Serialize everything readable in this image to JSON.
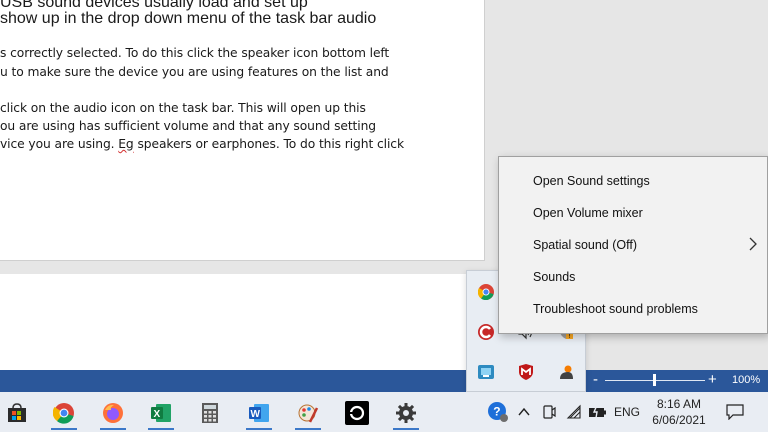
{
  "document": {
    "heading_lines": [
      "USB sound devices usually load and set up",
      "show up in the drop down menu of the task bar audio"
    ],
    "body_lines": [
      "s correctly selected. To do this click the speaker icon bottom left",
      "u to make sure the device you are using features on the list and",
      "",
      "click on the audio icon on the task bar. This will open up this",
      "ou are using has sufficient volume and that any sound setting"
    ],
    "last_line_before": "vice you are using. ",
    "last_line_misspelled": "Eg",
    "last_line_after": " speakers or earphones. To do this right click"
  },
  "statusbar": {
    "zoom_minus": "-",
    "zoom_plus": "+",
    "zoom_percent": "100%"
  },
  "context_menu": {
    "items": [
      {
        "label": "Open Sound settings"
      },
      {
        "label": "Open Volume mixer"
      },
      {
        "label": "Spatial sound (Off)",
        "has_submenu": true
      },
      {
        "label": "Sounds"
      },
      {
        "label": "Troubleshoot sound problems"
      }
    ]
  },
  "hidden_icons": [
    "chrome-icon",
    "ccleaner-icon",
    "volume-icon",
    "shield-warning-icon",
    "network-app-icon",
    "mcafee-icon",
    "user-app-icon"
  ],
  "taskbar": {
    "apps": [
      "store-icon",
      "chrome-icon",
      "firefox-icon",
      "excel-icon",
      "calculator-icon",
      "word-icon",
      "paint-icon",
      "media-icon",
      "settings-icon"
    ],
    "language": "ENG",
    "time": "8:16 AM",
    "date": "6/06/2021"
  },
  "colors": {
    "statusbar": "#2b579a",
    "taskbar": "#e9edf3",
    "menu_bg": "#f2f2f2",
    "active_underline": "#3c78c8"
  }
}
